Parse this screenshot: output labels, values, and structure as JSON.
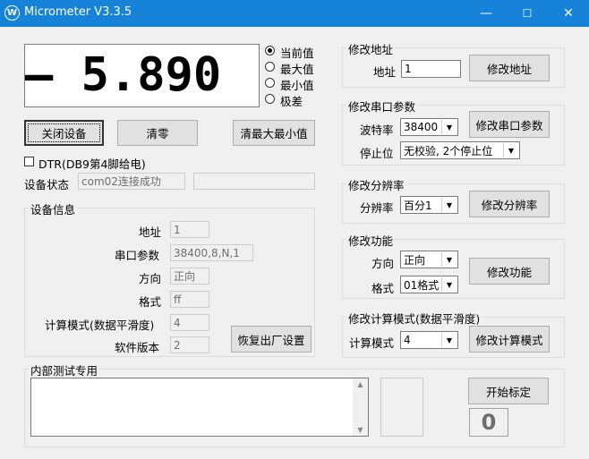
{
  "window": {
    "title": "Micrometer V3.3.5",
    "app_icon_glyph": "W",
    "minimize_glyph": "—",
    "maximize_glyph": "☐",
    "close_glyph": "✕"
  },
  "display": {
    "reading": "– 5.890"
  },
  "mode": {
    "options": [
      "当前值",
      "最大值",
      "最小值",
      "极差"
    ],
    "selected_index": 0
  },
  "buttons": {
    "close_device": "关闭设备",
    "zero": "清零",
    "clear_max_min": "清最大最小值",
    "factory_reset": "恢复出厂设置",
    "start_calibration": "开始标定"
  },
  "dtr": {
    "label": "DTR(DB9第4脚给电)",
    "checked": false
  },
  "status": {
    "label": "设备状态",
    "value": "com02连接成功",
    "extra": ""
  },
  "device_info": {
    "title": "设备信息",
    "rows": [
      {
        "label": "地址",
        "value": "1"
      },
      {
        "label": "串口参数",
        "value": "38400,8,N,1"
      },
      {
        "label": "方向",
        "value": "正向"
      },
      {
        "label": "格式",
        "value": "ff"
      },
      {
        "label": "计算模式(数据平滑度)",
        "value": "4"
      },
      {
        "label": "软件版本",
        "value": "2"
      }
    ]
  },
  "test": {
    "title": "内部测试专用",
    "text": "",
    "count": "0"
  },
  "address": {
    "title": "修改地址",
    "label": "地址",
    "value": "1",
    "button": "修改地址"
  },
  "serial": {
    "title": "修改串口参数",
    "baud_label": "波特率",
    "baud_value": "38400",
    "stop_label": "停止位",
    "stop_value": "无校验, 2个停止位",
    "button": "修改串口参数"
  },
  "resolution": {
    "title": "修改分辨率",
    "label": "分辨率",
    "value": "百分1",
    "button": "修改分辨率"
  },
  "function": {
    "title": "修改功能",
    "dir_label": "方向",
    "dir_value": "正向",
    "fmt_label": "格式",
    "fmt_value": "01格式",
    "button": "修改功能"
  },
  "calc": {
    "title": "修改计算模式(数据平滑度)",
    "label": "计算模式",
    "value": "4",
    "button": "修改计算模式"
  },
  "icons": {
    "combo_arrow": "▼",
    "scroll_up": "▲",
    "scroll_down": "▼"
  }
}
